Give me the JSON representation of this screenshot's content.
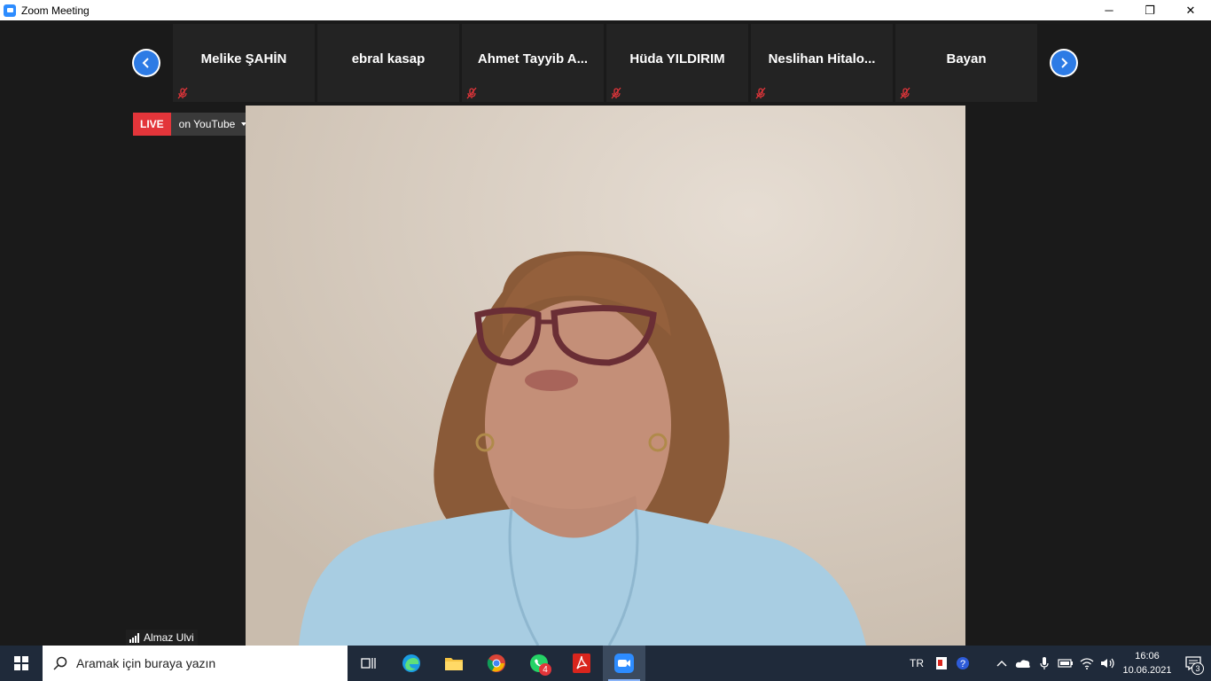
{
  "window": {
    "title": "Zoom Meeting",
    "minimize": "─",
    "maximize": "❐",
    "close": "✕"
  },
  "participants": [
    {
      "name": "Melike ŞAHİN",
      "muted": true
    },
    {
      "name": "ebral kasap",
      "muted": false
    },
    {
      "name": "Ahmet  Tayyib  A...",
      "muted": true
    },
    {
      "name": "Hüda YILDIRIM",
      "muted": true
    },
    {
      "name": "Neslihan  Hitalo...",
      "muted": true
    },
    {
      "name": "Bayan",
      "muted": true
    }
  ],
  "live": {
    "tag": "LIVE",
    "platform": "on YouTube"
  },
  "speaker": {
    "name": "Almaz Ulvi"
  },
  "taskbar": {
    "search_placeholder": "Aramak için buraya yazın",
    "whatsapp_badge": "4"
  },
  "tray": {
    "language": "TR",
    "time": "16:06",
    "date": "10.06.2021",
    "notifications": "3"
  },
  "colors": {
    "accent_blue": "#2d7be5",
    "live_red": "#e3353a",
    "background": "#1a1a1a"
  }
}
